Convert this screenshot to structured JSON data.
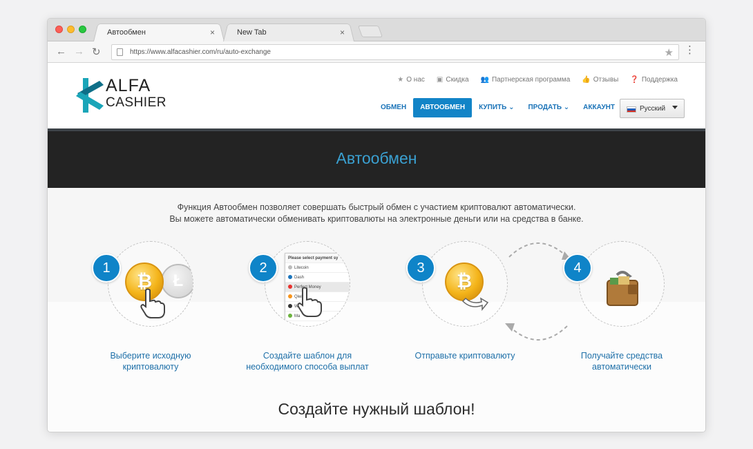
{
  "browser": {
    "tabs": [
      {
        "title": "Автообмен",
        "active": true
      },
      {
        "title": "New Tab",
        "active": false
      }
    ],
    "url": "https://www.alfacashier.com/ru/auto-exchange",
    "close_symbol": "×"
  },
  "logo": {
    "line1": "ALFA",
    "line2": "CASHIER"
  },
  "top_links": [
    {
      "label": "О нас",
      "icon": "star-icon",
      "glyph": "★"
    },
    {
      "label": "Скидка",
      "icon": "ticket-icon",
      "glyph": "▣"
    },
    {
      "label": "Партнерская программа",
      "icon": "users-icon",
      "glyph": "👥"
    },
    {
      "label": "Отзывы",
      "icon": "thumbs-up-icon",
      "glyph": "👍"
    },
    {
      "label": "Поддержка",
      "icon": "help-icon",
      "glyph": "❓"
    }
  ],
  "nav": [
    {
      "label": "ОБМЕН",
      "active": false
    },
    {
      "label": "АВТООБМЕН",
      "active": true
    },
    {
      "label": "КУПИТЬ ⌄",
      "active": false
    },
    {
      "label": "ПРОДАТЬ ⌄",
      "active": false
    },
    {
      "label": "АККАУНТ",
      "active": false
    }
  ],
  "language": {
    "selected": "Русский"
  },
  "banner": {
    "title": "Автообмен"
  },
  "intro": {
    "line1": "Функция Автообмен позволяет совершать быстрый обмен с участием криптовалют автоматически.",
    "line2": "Вы можете автоматически обменивать криптовалюты на электронные деньги или на средства в банке."
  },
  "payment_list": {
    "header": "Please select payment sy",
    "items": [
      "Litecoin",
      "Dash",
      "Perfect Money",
      "Qiwi",
      "Web",
      "Ma"
    ]
  },
  "steps": [
    {
      "number": "1",
      "line1": "Выберите исходную",
      "line2": "криптовалюту"
    },
    {
      "number": "2",
      "line1": "Создайте шаблон для",
      "line2": "необходимого способа выплат"
    },
    {
      "number": "3",
      "line1": "Отправьте криптовалюту",
      "line2": ""
    },
    {
      "number": "4",
      "line1": "Получайте средства",
      "line2": "автоматически"
    }
  ],
  "subtitle": "Создайте нужный шаблон!",
  "colors": {
    "accent": "#1284c7",
    "link": "#1d6fa8",
    "banner_bg": "#232323",
    "banner_text": "#3aa0d1",
    "coin": "#f4b41a"
  }
}
